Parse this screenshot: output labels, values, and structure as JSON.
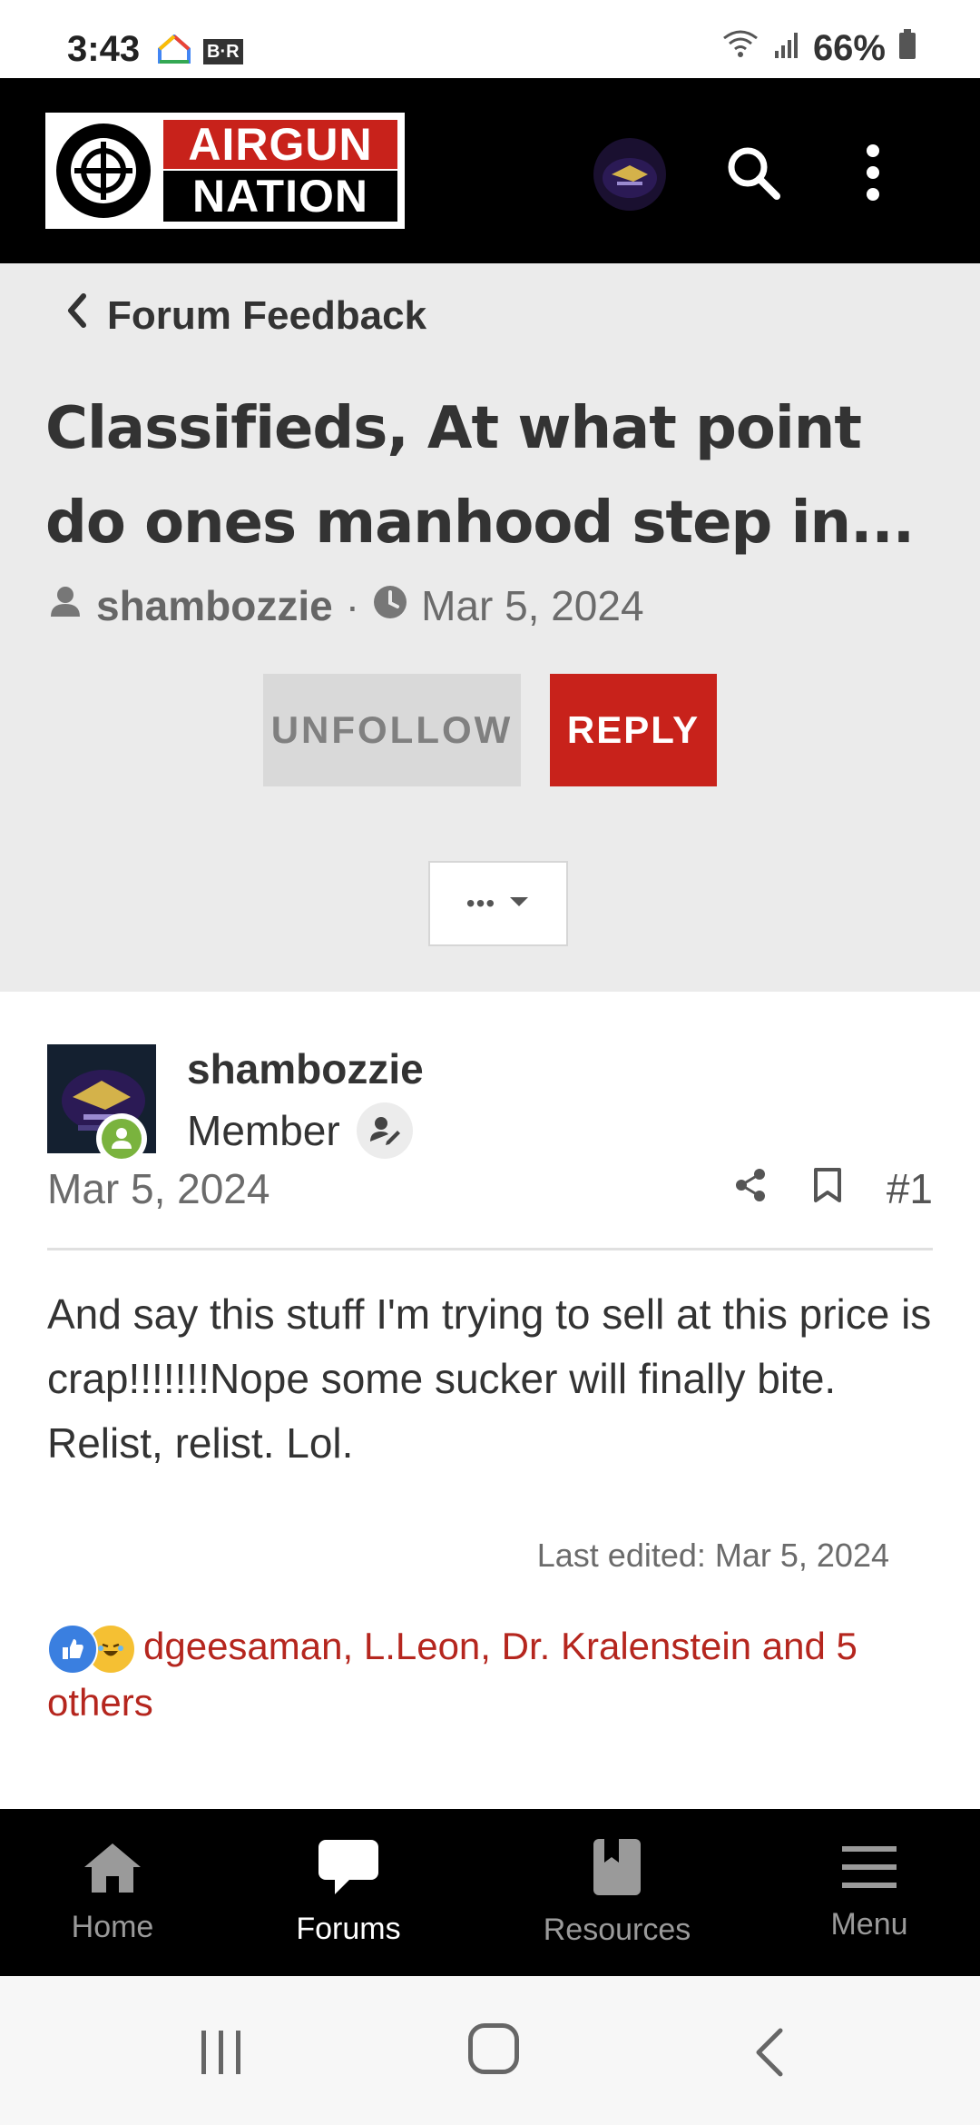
{
  "status_bar": {
    "time": "3:43",
    "left_icons": [
      "google-home-icon",
      "bleacher-report-icon"
    ],
    "bleacher_report_label": "B·R",
    "battery": "66%",
    "right_icons": [
      "wifi-icon",
      "signal-icon",
      "battery-icon"
    ]
  },
  "app_bar": {
    "logo_line1": "AIRGUN",
    "logo_line2": "NATION",
    "icons": [
      "avatar",
      "search-icon",
      "more-vert-icon"
    ]
  },
  "thread": {
    "breadcrumb": "Forum Feedback",
    "title": "Classifieds, At what point do ones manhood step in...",
    "author": "shambozzie",
    "date": "Mar 5, 2024",
    "unfollow_label": "UNFOLLOW",
    "reply_label": "REPLY",
    "more_label": "•••"
  },
  "post": {
    "author": "shambozzie",
    "role": "Member",
    "date": "Mar 5, 2024",
    "number": "#1",
    "body": "And say this stuff I'm trying to sell at this price is crap!!!!!!!Nope some sucker will finally bite. Relist, relist. Lol.",
    "last_edited": "Last edited: Mar 5, 2024",
    "reactions": "dgeesaman, L.Leon, Dr. Kralenstein and 5 others"
  },
  "bottom_nav": {
    "items": [
      {
        "label": "Home",
        "icon": "home-icon",
        "active": false
      },
      {
        "label": "Forums",
        "icon": "forums-icon",
        "active": true
      },
      {
        "label": "Resources",
        "icon": "resources-icon",
        "active": false
      },
      {
        "label": "Menu",
        "icon": "menu-icon",
        "active": false
      }
    ]
  },
  "colors": {
    "brand_red": "#c8221b",
    "header_bg": "#ebebeb",
    "online_green": "#7ab33e"
  }
}
